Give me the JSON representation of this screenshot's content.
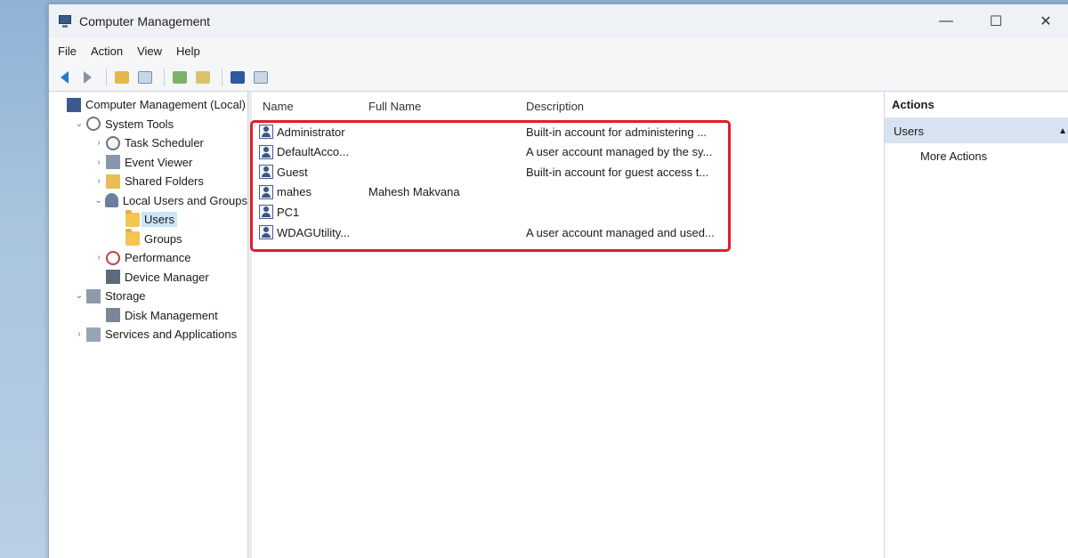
{
  "window": {
    "title": "Computer Management"
  },
  "menu": [
    "File",
    "Action",
    "View",
    "Help"
  ],
  "tree": [
    {
      "label": "Computer Management (Local)",
      "level": 0,
      "exp": "",
      "icon": "computer-icon"
    },
    {
      "label": "System Tools",
      "level": 1,
      "exp": "⌄",
      "icon": "tools-icon"
    },
    {
      "label": "Task Scheduler",
      "level": 2,
      "exp": "›",
      "icon": "clock-icon"
    },
    {
      "label": "Event Viewer",
      "level": 2,
      "exp": "›",
      "icon": "log-icon"
    },
    {
      "label": "Shared Folders",
      "level": 2,
      "exp": "›",
      "icon": "shared-folder-icon"
    },
    {
      "label": "Local Users and Groups",
      "level": 2,
      "exp": "⌄",
      "icon": "users-icon"
    },
    {
      "label": "Users",
      "level": 3,
      "exp": "",
      "icon": "folder-icon",
      "selected": true
    },
    {
      "label": "Groups",
      "level": 3,
      "exp": "",
      "icon": "folder-icon"
    },
    {
      "label": "Performance",
      "level": 2,
      "exp": "›",
      "icon": "performance-icon"
    },
    {
      "label": "Device Manager",
      "level": 2,
      "exp": "",
      "icon": "device-icon"
    },
    {
      "label": "Storage",
      "level": 1,
      "exp": "⌄",
      "icon": "storage-icon"
    },
    {
      "label": "Disk Management",
      "level": 2,
      "exp": "",
      "icon": "disk-icon"
    },
    {
      "label": "Services and Applications",
      "level": 1,
      "exp": "›",
      "icon": "services-icon"
    }
  ],
  "list": {
    "columns": {
      "name": "Name",
      "fullname": "Full Name",
      "description": "Description"
    },
    "rows": [
      {
        "name": "Administrator",
        "fullname": "",
        "description": "Built-in account for administering ..."
      },
      {
        "name": "DefaultAcco...",
        "fullname": "",
        "description": "A user account managed by the sy..."
      },
      {
        "name": "Guest",
        "fullname": "",
        "description": "Built-in account for guest access t..."
      },
      {
        "name": "mahes",
        "fullname": "Mahesh Makvana",
        "description": ""
      },
      {
        "name": "PC1",
        "fullname": "",
        "description": ""
      },
      {
        "name": "WDAGUtility...",
        "fullname": "",
        "description": "A user account managed and used..."
      }
    ]
  },
  "actions": {
    "title": "Actions",
    "section": "Users",
    "item": "More Actions"
  },
  "colors": {
    "highlight": "#e01e2a",
    "selection": "#cce4f7",
    "section_bg": "#d7e3f0"
  }
}
